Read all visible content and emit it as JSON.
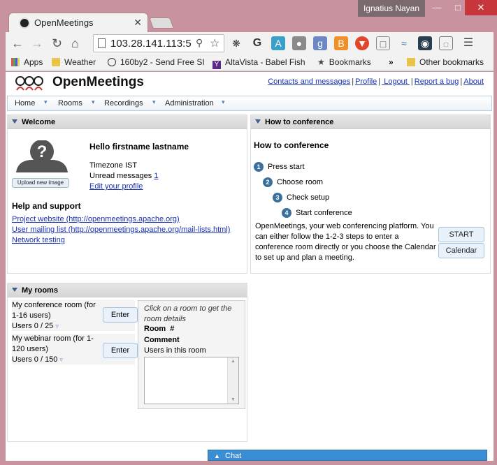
{
  "browser": {
    "tab_title": "OpenMeetings",
    "user": "Ignatius Nayan",
    "url": "103.28.141.113:5",
    "bookmarks": [
      {
        "label": "Apps"
      },
      {
        "label": "Weather"
      },
      {
        "label": "160by2 - Send Free SI"
      },
      {
        "label": "AltaVista - Babel Fish"
      },
      {
        "label": "Bookmarks"
      },
      {
        "label": "»"
      },
      {
        "label": "Other bookmarks"
      }
    ]
  },
  "app": {
    "name": "OpenMeetings",
    "top_links": [
      "Contacts and messages",
      "Profile",
      " Logout ",
      "Report a bug",
      "About"
    ],
    "menu": [
      "Home",
      "Rooms",
      "Recordings",
      "Administration"
    ]
  },
  "welcome": {
    "title": "Welcome",
    "upload_label": "Upload new image",
    "hello": "Hello firstname lastname",
    "timezone": "Timezone IST",
    "unread_label": "Unread messages",
    "unread_count": "1",
    "edit_profile": "Edit your profile",
    "help_title": "Help and support",
    "links": [
      "Project website (http://openmeetings.apache.org)",
      "User mailing list (http://openmeetings.apache.org/mail-lists.html)",
      "Network testing"
    ]
  },
  "how": {
    "panel_title": "How to conference",
    "title": "How to conference",
    "steps": [
      {
        "num": "1",
        "label": "Press start"
      },
      {
        "num": "2",
        "label": "Choose room"
      },
      {
        "num": "3",
        "label": "Check setup"
      },
      {
        "num": "4",
        "label": "Start conference"
      }
    ],
    "description": "OpenMeetings, your web conferencing platform. You can either follow the 1-2-3 steps to enter a conference room directly or you choose the Calendar to set up and plan a meeting.",
    "start_label": "START",
    "calendar_label": "Calendar"
  },
  "rooms": {
    "title": "My rooms",
    "list": [
      {
        "name": "My conference room (for 1-16 users)",
        "users": "Users 0 / 25",
        "enter": "Enter"
      },
      {
        "name": "My webinar room (for 1-120 users)",
        "users": "Users 0 / 150",
        "enter": "Enter"
      }
    ],
    "details_hint": "Click on a room to get the room details",
    "room_label": "Room",
    "room_hash": "#",
    "comment_label": "Comment",
    "users_label": "Users in this room"
  },
  "chat": {
    "label": "Chat"
  }
}
